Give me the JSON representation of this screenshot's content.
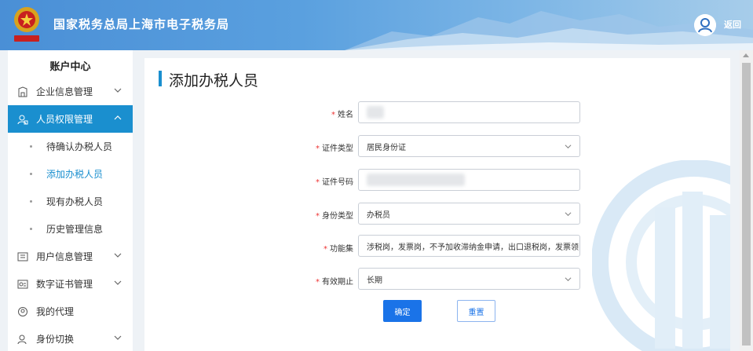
{
  "header": {
    "title": "国家税务总局上海市电子税务局",
    "logout_label": "返回"
  },
  "sidebar": {
    "title": "账户中心",
    "items": [
      {
        "label": "企业信息管理",
        "icon": "building-icon"
      },
      {
        "label": "人员权限管理",
        "icon": "person-lock-icon",
        "active": true
      },
      {
        "label": "用户信息管理",
        "icon": "user-card-icon"
      },
      {
        "label": "数字证书管理",
        "icon": "certificate-icon"
      },
      {
        "label": "我的代理",
        "icon": "agent-icon"
      },
      {
        "label": "身份切换",
        "icon": "switch-identity-icon"
      }
    ],
    "sub_items": [
      {
        "label": "待确认办税人员"
      },
      {
        "label": "添加办税人员",
        "current": true
      },
      {
        "label": "现有办税人员"
      },
      {
        "label": "历史管理信息"
      }
    ]
  },
  "main": {
    "page_title": "添加办税人员",
    "form": {
      "name": {
        "label": "姓名",
        "value": ""
      },
      "id_type": {
        "label": "证件类型",
        "value": "居民身份证"
      },
      "id_number": {
        "label": "证件号码",
        "value": ""
      },
      "identity_type": {
        "label": "身份类型",
        "value": "办税员"
      },
      "functions": {
        "label": "功能集",
        "value": "涉税岗，发票岗，不予加收滞纳金申请，出口退税岗，发票领"
      },
      "validity": {
        "label": "有效期止",
        "value": "长期"
      }
    },
    "confirm_label": "确定",
    "reset_label": "重置"
  },
  "colors": {
    "accent": "#1a8fcf",
    "primary_button": "#1a73e8",
    "required_mark": "#e33333"
  }
}
